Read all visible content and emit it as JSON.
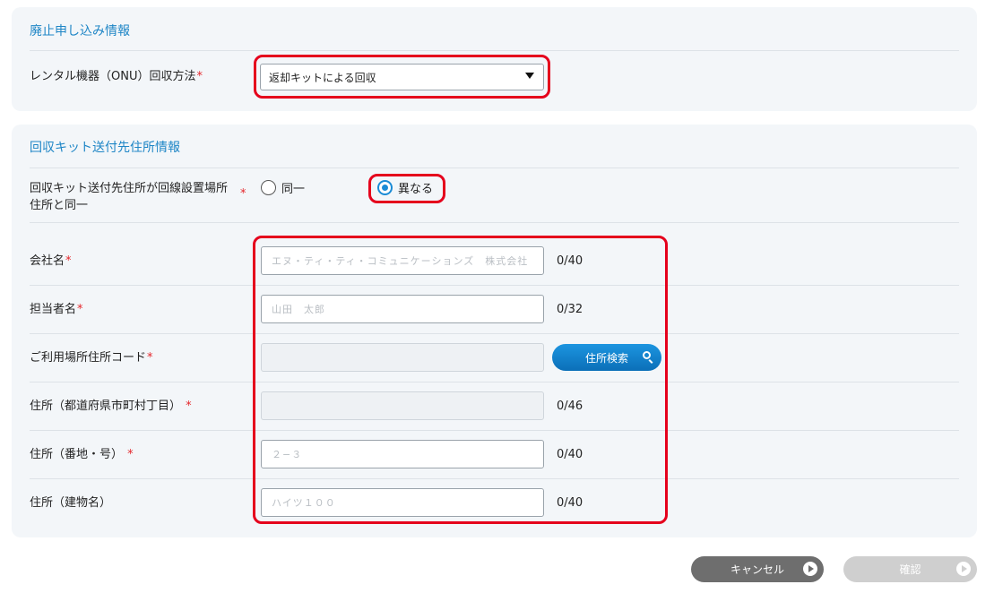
{
  "section1": {
    "title": "廃止申し込み情報",
    "method_label": "レンタル機器（ONU）回収方法",
    "method_value": "返却キットによる回収"
  },
  "section2": {
    "title": "回収キット送付先住所情報",
    "same_address_label_line1": "回収キット送付先住所が回線設置場所",
    "same_address_label_line2": "住所と同一",
    "radio_same": "同一",
    "radio_different": "異なる",
    "selected": "異なる",
    "fields": [
      {
        "label": "会社名",
        "required": true,
        "placeholder": "エヌ・ティ・ティ・コミュニケーションズ　株式会社",
        "count": "0/40"
      },
      {
        "label": "担当者名",
        "required": true,
        "placeholder": "山田　太郎",
        "count": "0/32"
      },
      {
        "label": "ご利用場所住所コード",
        "required": true,
        "placeholder": "",
        "count": ""
      },
      {
        "label": "住所（都道府県市町村丁目）",
        "required": true,
        "placeholder": "",
        "count": "0/46"
      },
      {
        "label": "住所（番地・号）",
        "required": true,
        "placeholder": "２−３",
        "count": "0/40"
      },
      {
        "label": "住所（建物名）",
        "required": false,
        "placeholder": "ハイツ１００",
        "count": "0/40"
      }
    ],
    "search_button": "住所検索"
  },
  "footer": {
    "cancel": "キャンセル",
    "confirm": "確認"
  },
  "colors": {
    "accent": "#1f86c6",
    "required": "#e5262b",
    "highlight": "#e5001c"
  }
}
